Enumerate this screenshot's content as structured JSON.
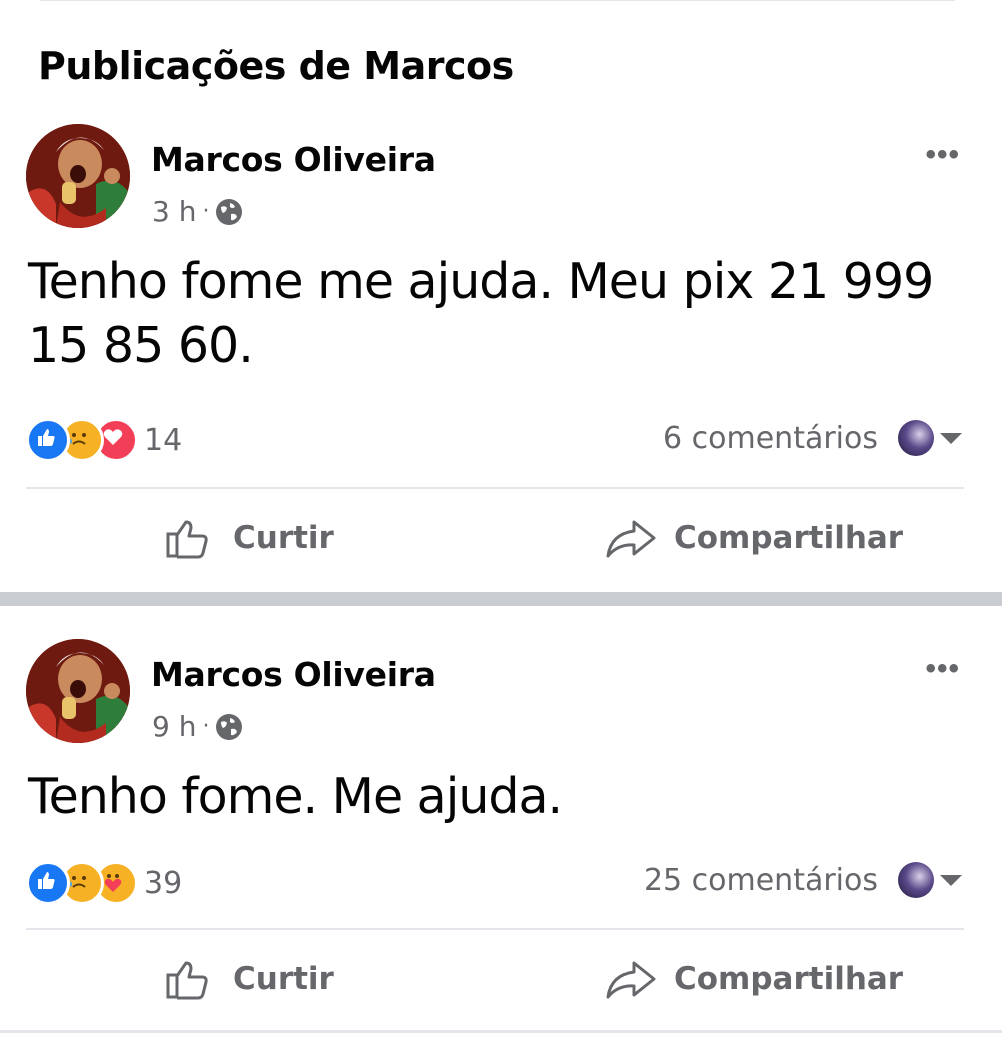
{
  "section": {
    "title": "Publicações de Marcos"
  },
  "posts": [
    {
      "author": "Marcos Oliveira",
      "time": "3 h",
      "separator": "·",
      "privacy_icon": "globe-icon",
      "text": "Tenho fome me ajuda. Meu pix 21 999 15 85 60.",
      "reactions": [
        "like",
        "sad",
        "love"
      ],
      "reaction_count": "14",
      "comments": "6 comentários",
      "more": "•••"
    },
    {
      "author": "Marcos Oliveira",
      "time": "9 h",
      "separator": "·",
      "privacy_icon": "globe-icon",
      "text": "Tenho fome. Me ajuda.",
      "reactions": [
        "like",
        "sad",
        "care"
      ],
      "reaction_count": "39",
      "comments": "25 comentários",
      "more": "•••"
    }
  ],
  "actions": {
    "like": "Curtir",
    "share": "Compartilhar"
  },
  "colors": {
    "like_blue": "#1877f2",
    "love_red": "#f33e58",
    "sad_yellow": "#f7b125",
    "secondary_text": "#65676b",
    "separator": "#c9ccd1"
  }
}
